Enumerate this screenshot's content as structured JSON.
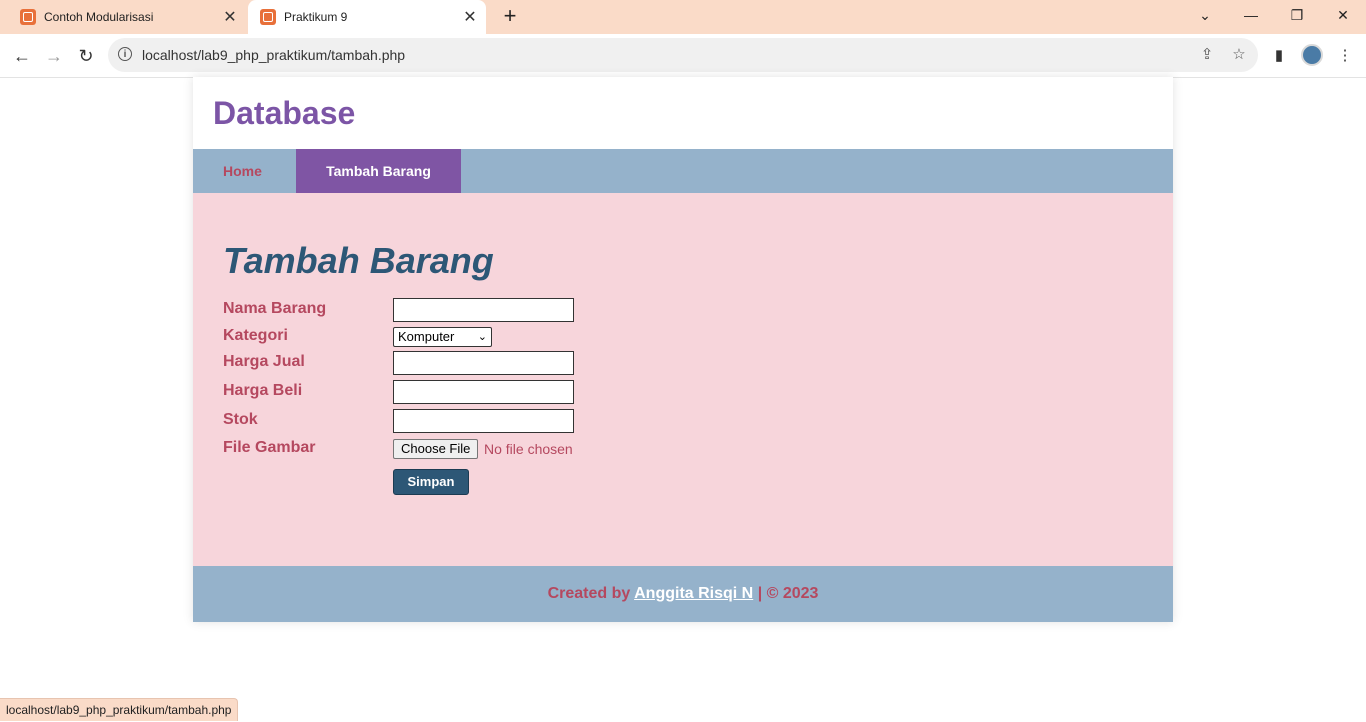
{
  "browser": {
    "tabs": [
      {
        "title": "Contoh Modularisasi",
        "active": false
      },
      {
        "title": "Praktikum 9",
        "active": true
      }
    ],
    "new_tab_symbol": "+",
    "url": "localhost/lab9_php_praktikum/tambah.php",
    "status_url": "localhost/lab9_php_praktikum/tambah.php"
  },
  "page": {
    "site_title": "Database",
    "nav": [
      {
        "label": "Home",
        "active": false
      },
      {
        "label": "Tambah Barang",
        "active": true
      }
    ],
    "heading": "Tambah Barang",
    "form": {
      "nama_barang_label": "Nama Barang",
      "nama_barang_value": "",
      "kategori_label": "Kategori",
      "kategori_selected": "Komputer",
      "harga_jual_label": "Harga Jual",
      "harga_jual_value": "",
      "harga_beli_label": "Harga Beli",
      "harga_beli_value": "",
      "stok_label": "Stok",
      "stok_value": "",
      "file_gambar_label": "File Gambar",
      "file_button": "Choose File",
      "file_status": "No file chosen",
      "submit_label": "Simpan"
    },
    "footer": {
      "prefix": "Created by",
      "author": "Anggita Risqi N",
      "suffix": "| © 2023"
    }
  },
  "colors": {
    "title": "#7c55a6",
    "nav_bg": "#95b2cb",
    "nav_active": "#7f55a4",
    "content_bg": "#f7d5db",
    "heading": "#2d5776",
    "label": "#b5485f"
  }
}
